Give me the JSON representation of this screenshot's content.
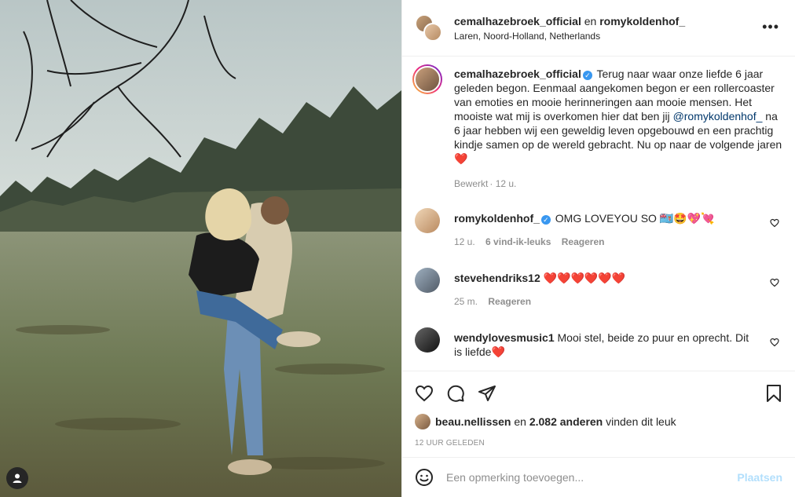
{
  "photo": {
    "tag_icon": "person-tag-icon"
  },
  "header": {
    "user1": "cemalhazebroek_official",
    "conjunction": "en",
    "user2": "romykoldenhof_",
    "location": "Laren, Noord-Holland, Netherlands",
    "more_icon": "more-horizontal-icon"
  },
  "caption": {
    "username": "cemalhazebroek_official",
    "text_before": "Terug naar waar onze liefde 6 jaar geleden begon. Eenmaal aangekomen begon er een rollercoaster van emoties en mooie herinneringen aan mooie mensen. Het mooiste wat mij is overkomen hier dat ben jij",
    "mention": "@romykoldenhof_",
    "text_after": "na 6 jaar hebben wij een geweldig leven opgebouwd en een prachtig kindje samen op de wereld gebracht. Nu op naar de volgende jaren ❤️",
    "edited": "Bewerkt",
    "time": "12 u."
  },
  "comments": [
    {
      "username": "romykoldenhof_",
      "text": "OMG LOVEYOU SO 🇫🇯🤩💖💘",
      "time": "12 u.",
      "likes": "6 vind-ik-leuks",
      "reply": "Reageren"
    },
    {
      "username": "stevehendriks12",
      "text": "❤️❤️❤️❤️❤️❤️",
      "time": "25 m.",
      "reply": "Reageren"
    },
    {
      "username": "wendylovesmusic1",
      "text": "Mooi stel, beide zo puur en oprecht. Dit is liefde❤️"
    }
  ],
  "likes": {
    "first_user": "beau.nellissen",
    "conjunction": "en",
    "count": "2.082 anderen",
    "suffix": "vinden dit leuk"
  },
  "timestamp": "12 uur geleden",
  "add_comment": {
    "placeholder": "Een opmerking toevoegen...",
    "post_label": "Plaatsen"
  },
  "colors": {
    "link": "#00376b",
    "verified": "#3897f0",
    "post_disabled": "#b2dffc",
    "muted": "#8e8e8e"
  }
}
